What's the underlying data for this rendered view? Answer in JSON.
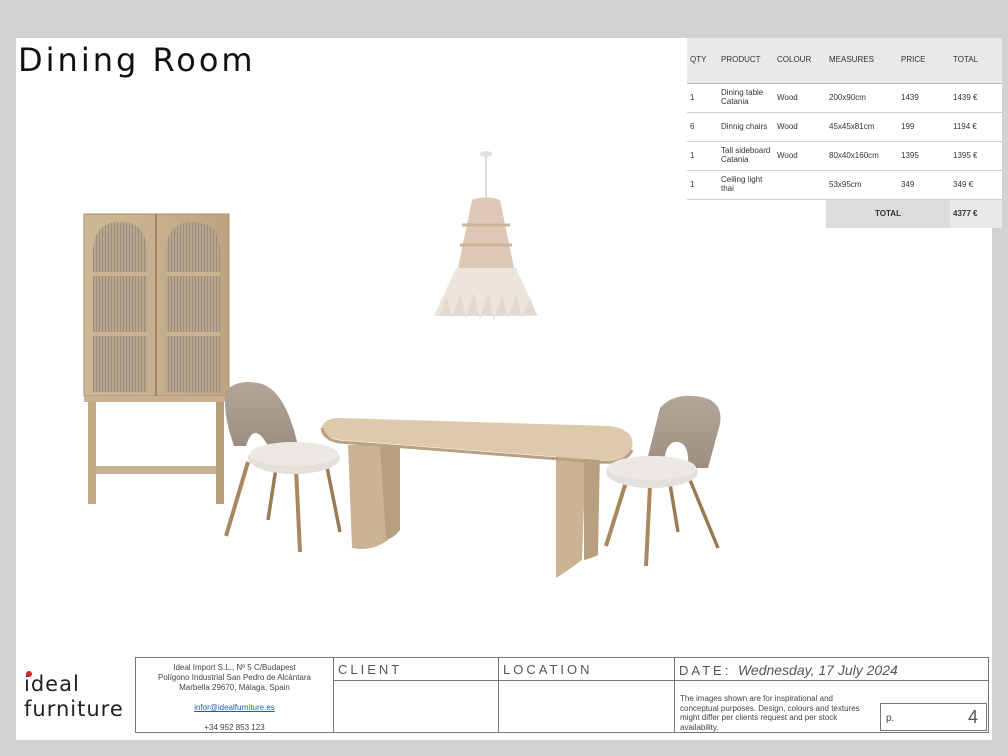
{
  "page": {
    "title": "Dining Room"
  },
  "price_table": {
    "headers": {
      "qty": "QTY",
      "product": "PRODUCT",
      "colour": "COLOUR",
      "measures": "MEASURES",
      "price": "PRICE",
      "total": "TOTAL"
    },
    "rows": [
      {
        "qty": "1",
        "product": "Dining table Catania",
        "colour": "Wood",
        "measures": "200x90cm",
        "price": "1439",
        "total": "1439 €"
      },
      {
        "qty": "6",
        "product": "Dinnig chairs",
        "colour": "Wood",
        "measures": "45x45x81cm",
        "price": "199",
        "total": "1194 €"
      },
      {
        "qty": "1",
        "product": "Tall sideboard Catania",
        "colour": "Wood",
        "measures": "80x40x160cm",
        "price": "1395",
        "total": "1395 €"
      },
      {
        "qty": "1",
        "product": "Ceiling light thai",
        "colour": "",
        "measures": "53x95cm",
        "price": "349",
        "total": "349 €"
      }
    ],
    "total_label": "TOTAL",
    "total_value": "4377 €"
  },
  "logo": {
    "line1": "ideal",
    "line2": "furniture",
    "dot_color": "#d0282e"
  },
  "footer": {
    "company": {
      "line1": "Ideal Import S.L., Nº 5 C/Budapest",
      "line2": "Polígono Industrial San Pedro de Alcántara",
      "line3": "Marbella 29670, Málaga, Spain",
      "email": "infor@idealfurniture.es",
      "phone": "+34 952 853 123"
    },
    "client_label": "CLIENT",
    "location_label": "LOCATION",
    "date_label": "DATE:",
    "date_value": "Wednesday, 17 July 2024",
    "disclaimer": "The images shown are for inspirational and conceptual purposes. Design, colours and textures might differ per clients request and per stock availability.",
    "page_label": "p.",
    "page_number": "4"
  }
}
